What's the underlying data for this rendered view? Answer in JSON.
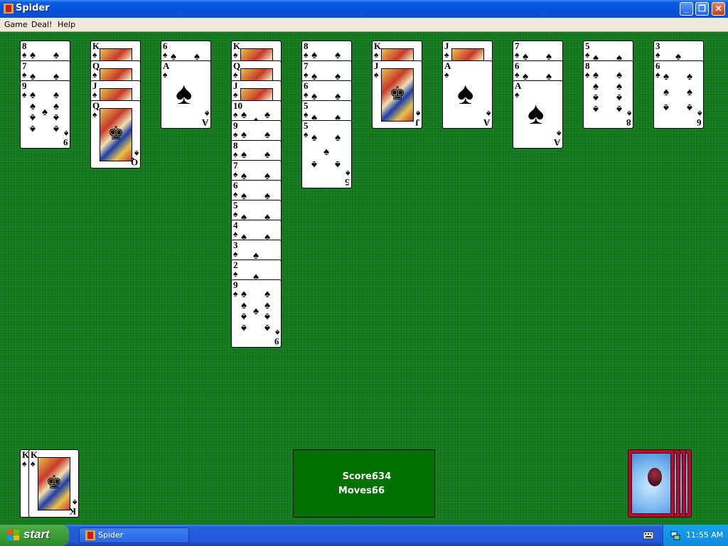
{
  "window": {
    "title": "Spider",
    "min_icon": "minimize-icon",
    "max_icon": "restore-icon",
    "close_icon": "close-icon"
  },
  "menu": [
    "Game",
    "Deal!",
    "Help"
  ],
  "columns": [
    {
      "cards": [
        {
          "rank": "8",
          "suit": "♠"
        },
        {
          "rank": "7",
          "suit": "♠"
        },
        {
          "rank": "9",
          "suit": "♠"
        }
      ]
    },
    {
      "cards": [
        {
          "rank": "K",
          "suit": "♠"
        },
        {
          "rank": "Q",
          "suit": "♠"
        },
        {
          "rank": "J",
          "suit": "♠"
        },
        {
          "rank": "Q",
          "suit": "♠"
        }
      ]
    },
    {
      "cards": [
        {
          "rank": "6",
          "suit": "♠"
        },
        {
          "rank": "A",
          "suit": "♠"
        }
      ]
    },
    {
      "cards": [
        {
          "rank": "K",
          "suit": "♠"
        },
        {
          "rank": "Q",
          "suit": "♠"
        },
        {
          "rank": "J",
          "suit": "♠"
        },
        {
          "rank": "10",
          "suit": "♠"
        },
        {
          "rank": "9",
          "suit": "♠"
        },
        {
          "rank": "8",
          "suit": "♠"
        },
        {
          "rank": "7",
          "suit": "♠"
        },
        {
          "rank": "6",
          "suit": "♠"
        },
        {
          "rank": "5",
          "suit": "♠"
        },
        {
          "rank": "4",
          "suit": "♠"
        },
        {
          "rank": "3",
          "suit": "♠"
        },
        {
          "rank": "2",
          "suit": "♠"
        },
        {
          "rank": "9",
          "suit": "♠"
        }
      ]
    },
    {
      "cards": [
        {
          "rank": "8",
          "suit": "♠"
        },
        {
          "rank": "7",
          "suit": "♠"
        },
        {
          "rank": "6",
          "suit": "♠"
        },
        {
          "rank": "5",
          "suit": "♠"
        },
        {
          "rank": "5",
          "suit": "♠"
        }
      ]
    },
    {
      "cards": [
        {
          "rank": "K",
          "suit": "♠"
        },
        {
          "rank": "J",
          "suit": "♠"
        }
      ]
    },
    {
      "cards": [
        {
          "rank": "J",
          "suit": "♠"
        },
        {
          "rank": "A",
          "suit": "♠"
        }
      ]
    },
    {
      "cards": [
        {
          "rank": "7",
          "suit": "♠"
        },
        {
          "rank": "6",
          "suit": "♠"
        },
        {
          "rank": "A",
          "suit": "♠"
        }
      ]
    },
    {
      "cards": [
        {
          "rank": "5",
          "suit": "♠"
        },
        {
          "rank": "8",
          "suit": "♠"
        }
      ]
    },
    {
      "cards": [
        {
          "rank": "3",
          "suit": "♠"
        },
        {
          "rank": "6",
          "suit": "♠"
        }
      ]
    }
  ],
  "completed": [
    {
      "rank": "K",
      "suit": "♠"
    },
    {
      "rank": "K",
      "suit": "♠"
    }
  ],
  "stock_piles": 4,
  "score": {
    "score_label": "Score:",
    "score_value": "634",
    "moves_label": "Moves:",
    "moves_value": "66"
  },
  "taskbar": {
    "start_label": "start",
    "task_label": "Spider",
    "clock": "11:55 AM"
  },
  "colors": {
    "felt": "#157a1f",
    "score_panel": "#007000",
    "taskbar": "#245edb",
    "start": "#3b9e36",
    "card_back": "#b2102a"
  }
}
